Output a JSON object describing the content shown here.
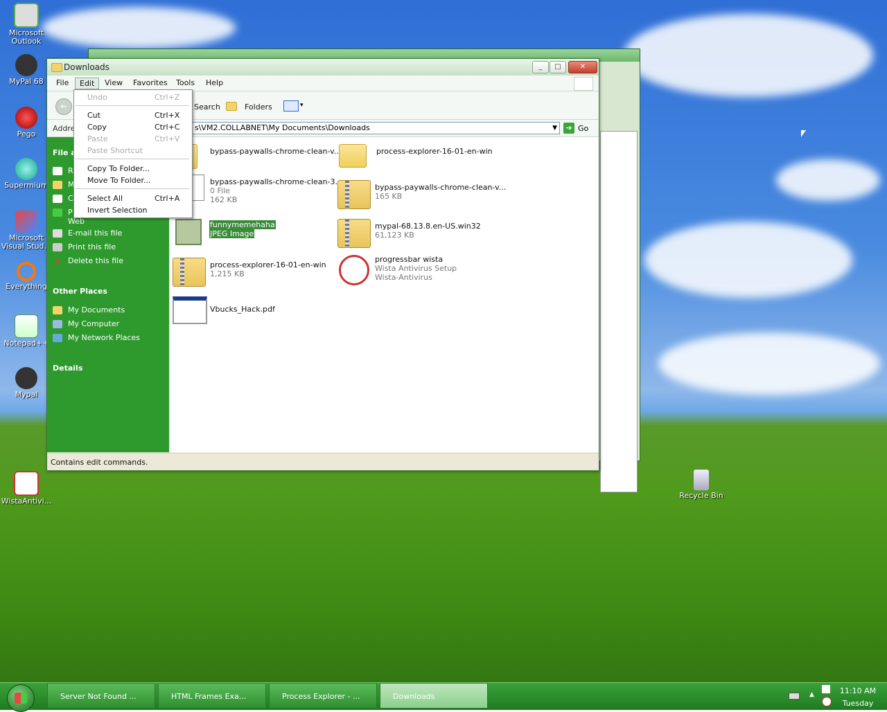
{
  "desktop_icons": [
    {
      "label": "Microsoft Outlook",
      "icon": "outlook-icon"
    },
    {
      "label": "MyPal 68",
      "icon": "mypal-icon"
    },
    {
      "label": "Pego",
      "icon": "pego-icon"
    },
    {
      "label": "Supermium",
      "icon": "supermium-icon"
    },
    {
      "label": "Microsoft Visual Stud...",
      "icon": "visual-studio-icon"
    },
    {
      "label": "Everything",
      "icon": "everything-icon"
    },
    {
      "label": "Notepad++",
      "icon": "notepadpp-icon"
    },
    {
      "label": "Mypal",
      "icon": "mypal-icon"
    },
    {
      "label": "WistaAntivi...",
      "icon": "wista-antivirus-icon"
    },
    {
      "label": "Recycle Bin",
      "icon": "recycle-bin-icon"
    }
  ],
  "window": {
    "title": "Downloads",
    "menu": {
      "file": "File",
      "edit": "Edit",
      "view": "View",
      "favorites": "Favorites",
      "tools": "Tools",
      "help": "Help"
    },
    "toolbar": {
      "search": "Search",
      "folders": "Folders"
    },
    "address": {
      "label": "Addre",
      "value": "s\\VM2.COLLABNET\\My Documents\\Downloads",
      "go": "Go"
    },
    "taskpane": {
      "file_heading": "File ar",
      "file_tasks_partial": [
        "R",
        "M",
        "C",
        "P"
      ],
      "web_label": "Web",
      "email": "E-mail this file",
      "print": "Print this file",
      "delete": "Delete this file",
      "other_places": "Other Places",
      "places": [
        "My Documents",
        "My Computer",
        "My Network Places"
      ],
      "details": "Details"
    },
    "files": [
      {
        "name": "bypass-paywalls-chrome-clean-v...",
        "type": "folder"
      },
      {
        "name": "process-explorer-16-01-en-win",
        "type": "folder"
      },
      {
        "name": "bypass-paywalls-chrome-clean-3...",
        "sub1": "0 File",
        "sub2": "162 KB",
        "type": "file"
      },
      {
        "name": "bypass-paywalls-chrome-clean-v...",
        "sub1": "165 KB",
        "type": "zip"
      },
      {
        "name": "funnymemehaha",
        "sub1": "JPEG Image",
        "type": "image"
      },
      {
        "name": "mypal-68.13.8.en-US.win32",
        "sub1": "61,123 KB",
        "type": "zip"
      },
      {
        "name": "process-explorer-16-01-en-win",
        "sub1": "1,215 KB",
        "type": "zip"
      },
      {
        "name": "progressbar wista",
        "sub1": "Wista Antivirus Setup",
        "sub2": "Wista-Antivirus",
        "type": "app"
      },
      {
        "name": "Vbucks_Hack.pdf",
        "type": "pdf"
      }
    ],
    "status": "Contains edit commands."
  },
  "edit_menu": {
    "undo": "Undo",
    "undo_sc": "Ctrl+Z",
    "cut": "Cut",
    "cut_sc": "Ctrl+X",
    "copy": "Copy",
    "copy_sc": "Ctrl+C",
    "paste": "Paste",
    "paste_sc": "Ctrl+V",
    "paste_shortcut": "Paste Shortcut",
    "copy_to": "Copy To Folder...",
    "move_to": "Move To Folder...",
    "select_all": "Select All",
    "select_all_sc": "Ctrl+A",
    "invert": "Invert Selection"
  },
  "taskbar": {
    "buttons": [
      "Server Not Found ...",
      "HTML Frames Exa...",
      "Process Explorer - ...",
      "Downloads"
    ],
    "time": "11:10 AM",
    "day": "Tuesday"
  }
}
